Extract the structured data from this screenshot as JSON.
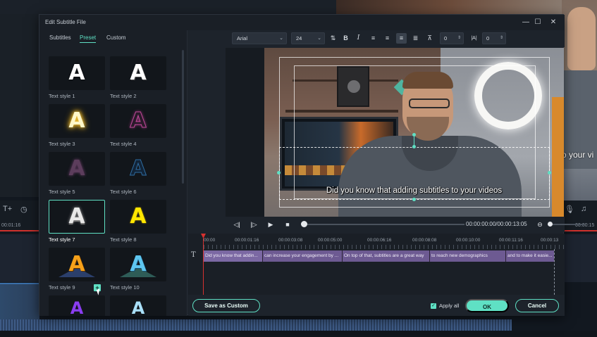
{
  "dialog": {
    "title": "Edit Subtitle File",
    "controls": {
      "minimize": "—",
      "maximize": "☐",
      "close": "✕"
    }
  },
  "tabs": [
    {
      "label": "Subtitles"
    },
    {
      "label": "Preset"
    },
    {
      "label": "Custom"
    }
  ],
  "active_tab": "Preset",
  "presets": [
    {
      "label": "Text style 1",
      "glyph": "A"
    },
    {
      "label": "Text style 2",
      "glyph": "A"
    },
    {
      "label": "Text style 3",
      "glyph": "A"
    },
    {
      "label": "Text style 4",
      "glyph": "A"
    },
    {
      "label": "Text style 5",
      "glyph": "A"
    },
    {
      "label": "Text style 6",
      "glyph": "A"
    },
    {
      "label": "Text style 7",
      "glyph": "A"
    },
    {
      "label": "Text style 8",
      "glyph": "A"
    },
    {
      "label": "Text style 9",
      "glyph": "A"
    },
    {
      "label": "Text style 10",
      "glyph": "A"
    },
    {
      "label": "",
      "glyph": "A"
    },
    {
      "label": "",
      "glyph": "A"
    }
  ],
  "selected_preset": "Text style 7",
  "format": {
    "font": "Arial",
    "size": "24",
    "bold": "B",
    "italic": "I",
    "spacing_value": "0",
    "line_value": "0"
  },
  "preview": {
    "subtitle_text": "Did you know that adding subtitles to your videos"
  },
  "transport": {
    "timecode": "00:00:00:00/00:00:13:05"
  },
  "timeline": {
    "ruler": [
      "00:00",
      "00:00:01:16",
      "00:00:03:08",
      "00:00:05:00",
      "00:00:06:16",
      "00:00:08:08",
      "00:00:10:00",
      "00:00:11:16",
      "00:00:13"
    ],
    "clips": [
      {
        "text": "Did you know that addin..."
      },
      {
        "text": "can increase your engagement by ..."
      },
      {
        "text": "On top of that, subtitles are a great way"
      },
      {
        "text": "to reach new demographics"
      },
      {
        "text": "and to make it easie..."
      }
    ]
  },
  "footer": {
    "save_custom": "Save as Custom",
    "apply_all": "Apply all",
    "ok": "OK",
    "cancel": "Cancel"
  },
  "background": {
    "times": [
      "00:01:16",
      "00:00:15"
    ],
    "preview_subtitle": "o your vi"
  },
  "colors": {
    "accent": "#5fe0c4",
    "playhead": "#d6312f",
    "subtitle_clip": "#6d5a92"
  }
}
